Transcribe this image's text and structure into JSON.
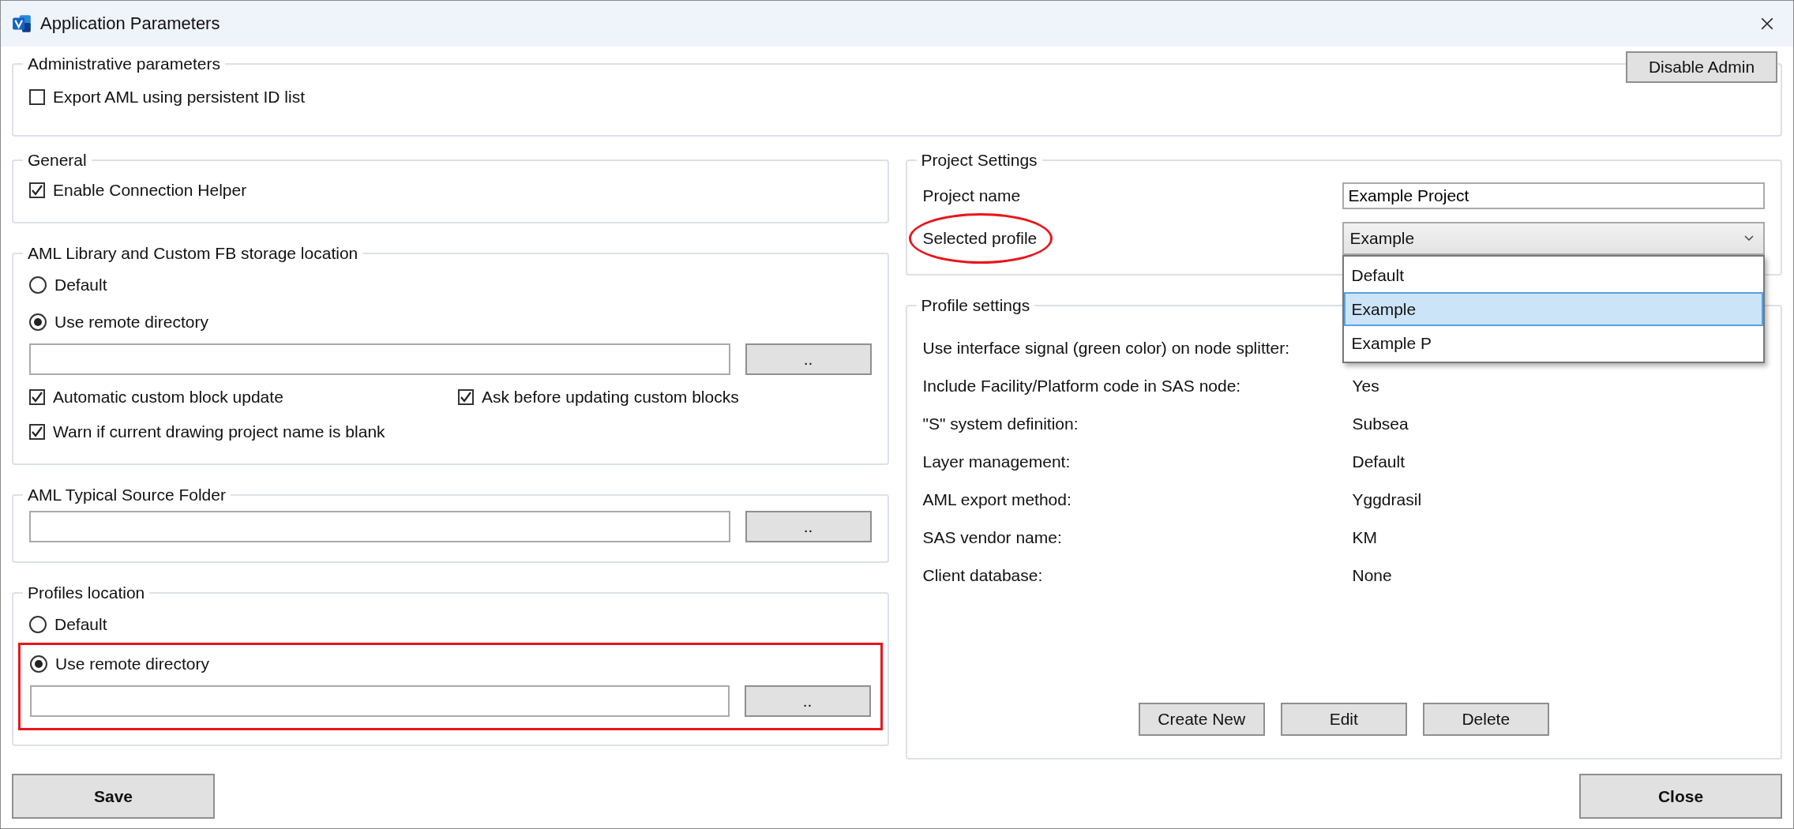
{
  "window": {
    "title": "Application Parameters"
  },
  "admin": {
    "title": "Administrative parameters",
    "button": "Disable Admin",
    "options": [
      {
        "label": "Export AML using persistent ID list",
        "checked": false
      }
    ]
  },
  "general": {
    "title": "General",
    "options": [
      {
        "label": "Enable Connection Helper",
        "checked": true
      }
    ]
  },
  "aml_library": {
    "title": "AML Library and Custom FB storage location",
    "locations": [
      {
        "label": "Default",
        "selected": false
      },
      {
        "label": "Use remote directory",
        "selected": true
      }
    ],
    "browse_button": "..",
    "options": [
      {
        "label": "Automatic custom block update",
        "checked": true
      },
      {
        "label": "Ask before updating custom blocks",
        "checked": true
      },
      {
        "label": "Warn if current drawing project name is blank",
        "checked": true
      }
    ]
  },
  "aml_typical": {
    "title": "AML Typical Source Folder",
    "browse_button": ".."
  },
  "profiles_location": {
    "title": "Profiles location",
    "locations": [
      {
        "label": "Default",
        "selected": false
      },
      {
        "label": "Use remote directory",
        "selected": true
      }
    ],
    "browse_button": "..",
    "remote_highlighted": true
  },
  "project_settings": {
    "title": "Project Settings",
    "name_label": "Project name",
    "name_value": "Example Project",
    "profile_label": "Selected profile",
    "profile_circled": true,
    "profile_value": "Example",
    "dropdown_open": true,
    "profile_options": [
      {
        "label": "Default",
        "selected": false
      },
      {
        "label": "Example",
        "selected": true
      },
      {
        "label": "Example P",
        "selected": false
      }
    ]
  },
  "profile_settings": {
    "title": "Profile settings",
    "rows": [
      {
        "label": "Use interface signal (green color) on node splitter:"
      },
      {
        "label": "Include Facility/Platform code in SAS node:",
        "value": "Yes"
      },
      {
        "label": "\"S\" system definition:",
        "value": "Subsea"
      },
      {
        "label": "Layer management:",
        "value": "Default"
      },
      {
        "label": "AML export method:",
        "value": "Yggdrasil"
      },
      {
        "label": "SAS vendor name:",
        "value": "KM"
      },
      {
        "label": "Client database:",
        "value": "None"
      }
    ],
    "buttons": [
      "Create New",
      "Edit",
      "Delete"
    ]
  },
  "footer": {
    "save": "Save",
    "close": "Close"
  }
}
